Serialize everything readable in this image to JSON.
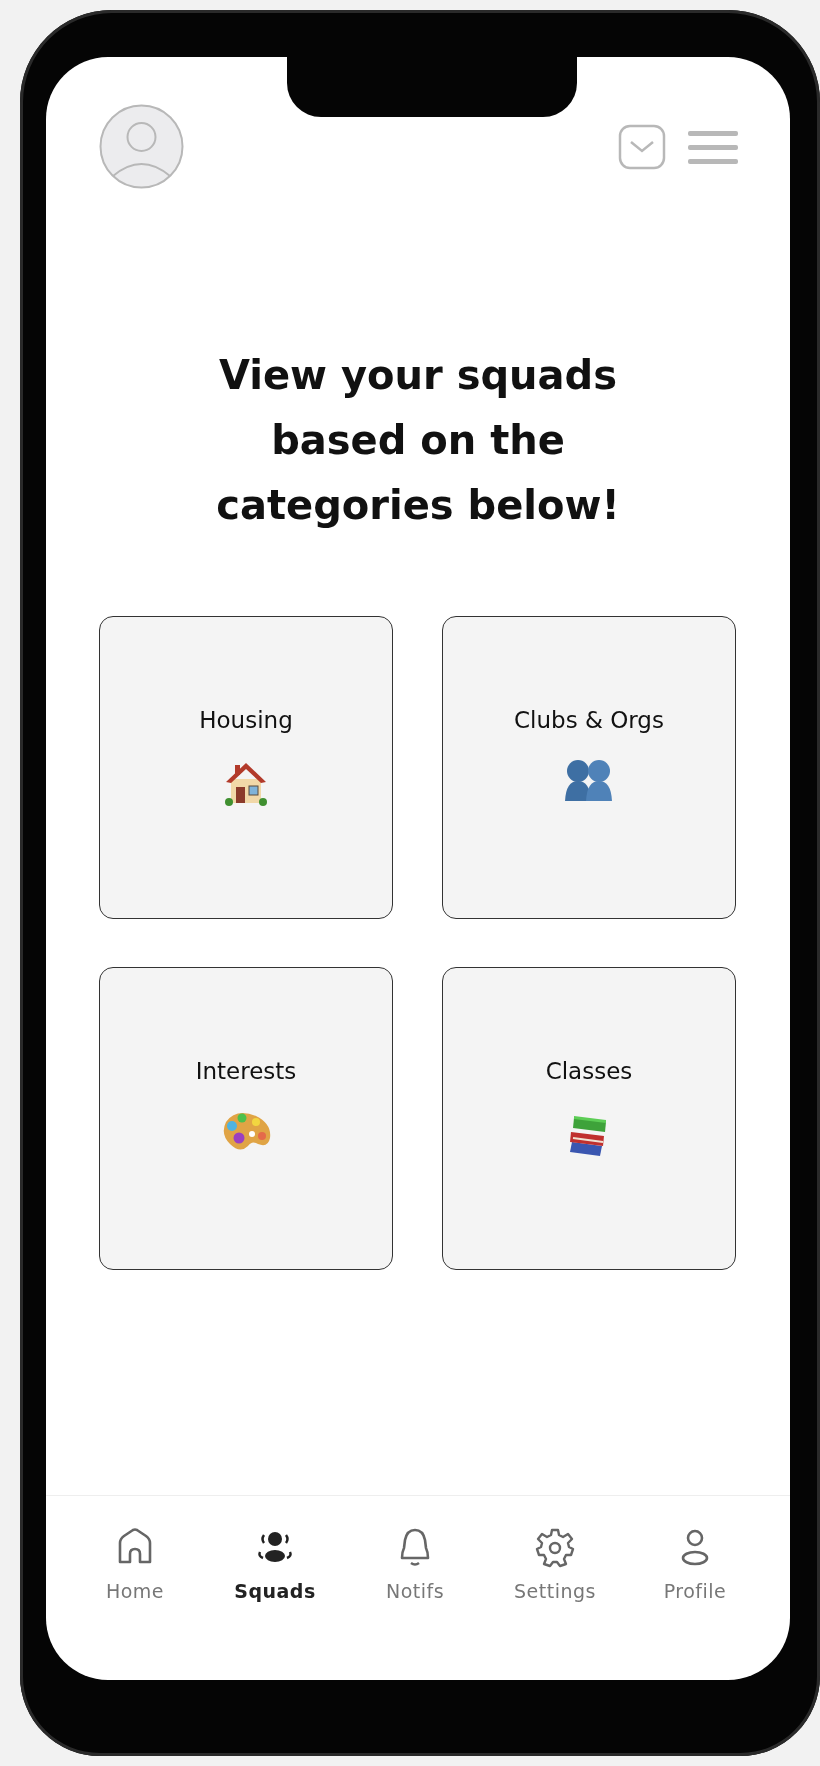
{
  "heading": "View your squads based on the categories below!",
  "categories": [
    {
      "label": "Housing"
    },
    {
      "label": "Clubs & Orgs"
    },
    {
      "label": "Interests"
    },
    {
      "label": "Classes"
    }
  ],
  "nav": [
    {
      "label": "Home",
      "selected": false
    },
    {
      "label": "Squads",
      "selected": true
    },
    {
      "label": "Notifs",
      "selected": false
    },
    {
      "label": "Settings",
      "selected": false
    },
    {
      "label": "Profile",
      "selected": false
    }
  ]
}
